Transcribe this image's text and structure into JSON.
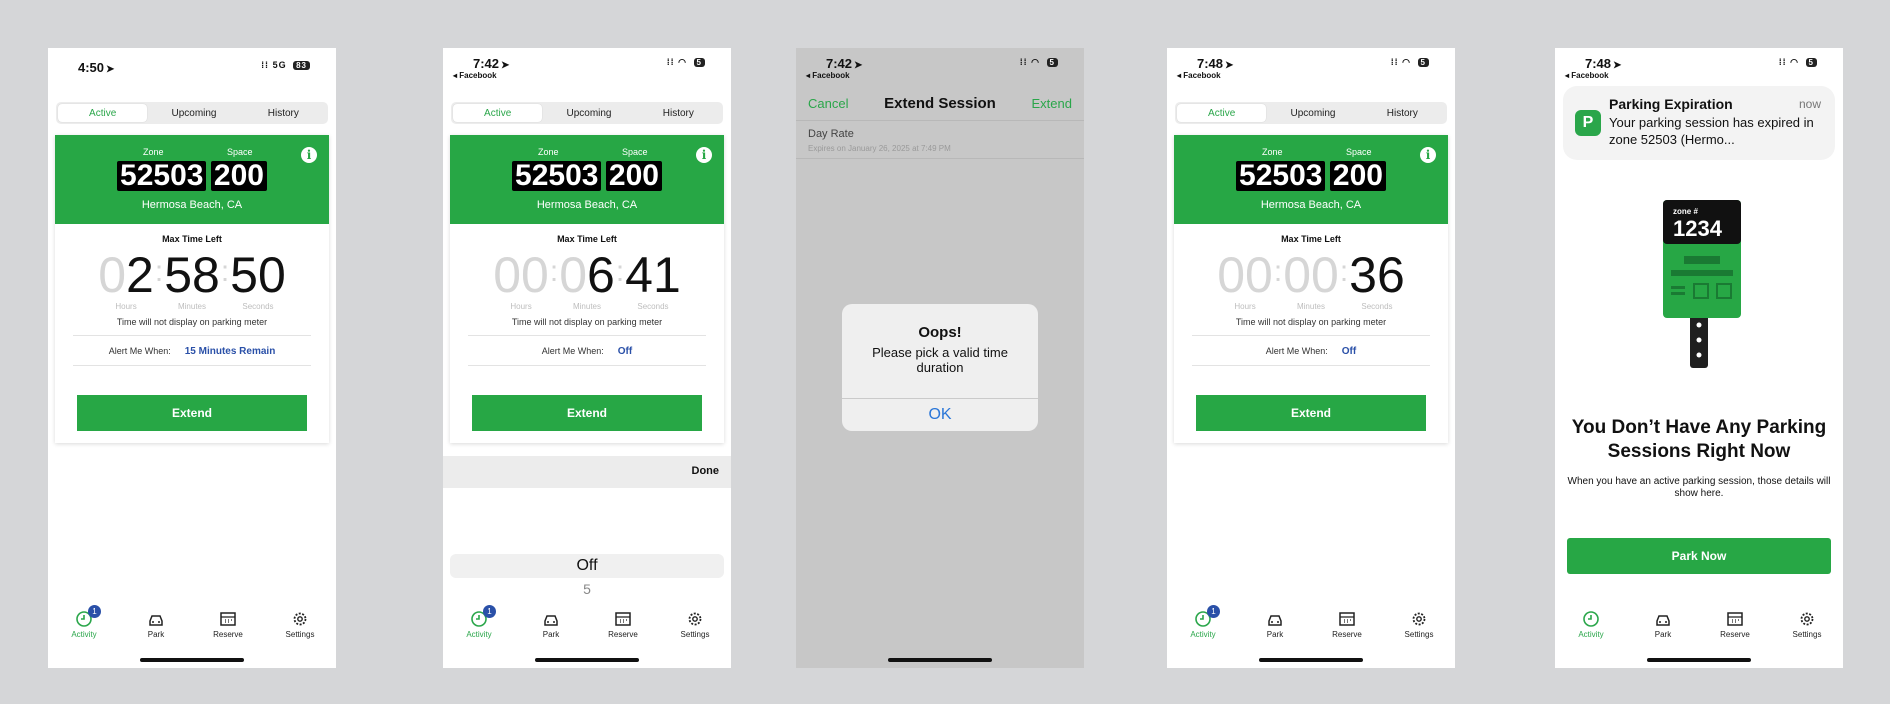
{
  "colors": {
    "brand_green": "#27a745",
    "alert_blue": "#2a50a8",
    "ios_blue": "#2a76d8"
  },
  "screen1": {
    "time": "4:50",
    "signal": "5G",
    "battery": "83",
    "tabs": [
      "Active",
      "Upcoming",
      "History"
    ],
    "zone_label": "Zone",
    "space_label": "Space",
    "zone": "52503",
    "space": "200",
    "city": "Hermosa Beach, CA",
    "max_time_label": "Max Time Left",
    "hours_dim": "0",
    "hours_main": "2",
    "minutes": "58",
    "seconds": "50",
    "unit_hours": "Hours",
    "unit_minutes": "Minutes",
    "unit_seconds": "Seconds",
    "meter_note": "Time will not display on parking meter",
    "alert_label": "Alert Me When:",
    "alert_value": "15 Minutes Remain",
    "extend": "Extend",
    "badge": "1",
    "nav": [
      "Activity",
      "Park",
      "Reserve",
      "Settings"
    ]
  },
  "screen2": {
    "time": "7:42",
    "back_app": "◂ Facebook",
    "battery": "5",
    "tabs": [
      "Active",
      "Upcoming",
      "History"
    ],
    "zone_label": "Zone",
    "space_label": "Space",
    "zone": "52503",
    "space": "200",
    "city": "Hermosa Beach, CA",
    "max_time_label": "Max Time Left",
    "hours": "00",
    "minutes_dim": "0",
    "minutes_main": "6",
    "seconds": "41",
    "unit_hours": "Hours",
    "unit_minutes": "Minutes",
    "unit_seconds": "Seconds",
    "meter_note": "Time will not display on parking meter",
    "alert_label": "Alert Me When:",
    "alert_value": "Off",
    "extend": "Extend",
    "done": "Done",
    "picker_selected": "Off",
    "picker_next": "5",
    "badge": "1",
    "nav": [
      "Activity",
      "Park",
      "Reserve",
      "Settings"
    ]
  },
  "screen3": {
    "time": "7:42",
    "back_app": "◂ Facebook",
    "battery": "5",
    "cancel": "Cancel",
    "title": "Extend Session",
    "extend": "Extend",
    "rate_title": "Day Rate",
    "rate_sub": "Expires on January 26, 2025 at 7:49 PM",
    "alert_title": "Oops!",
    "alert_message": "Please pick a valid time duration",
    "alert_ok": "OK"
  },
  "screen4": {
    "time": "7:48",
    "back_app": "◂ Facebook",
    "battery": "5",
    "tabs": [
      "Active",
      "Upcoming",
      "History"
    ],
    "zone_label": "Zone",
    "space_label": "Space",
    "zone": "52503",
    "space": "200",
    "city": "Hermosa Beach, CA",
    "max_time_label": "Max Time Left",
    "hours": "00",
    "minutes": "00",
    "seconds": "36",
    "unit_hours": "Hours",
    "unit_minutes": "Minutes",
    "unit_seconds": "Seconds",
    "meter_note": "Time will not display on parking meter",
    "alert_label": "Alert Me When:",
    "alert_value": "Off",
    "extend": "Extend",
    "badge": "1",
    "nav": [
      "Activity",
      "Park",
      "Reserve",
      "Settings"
    ]
  },
  "screen5": {
    "time": "7:48",
    "back_app": "◂ Facebook",
    "battery": "5",
    "notif_title": "Parking Expiration",
    "notif_time": "now",
    "notif_body": "Your parking session has expired in zone 52503 (Hermo...",
    "notif_icon": "P",
    "sign_zone_label": "zone #",
    "sign_zone": "1234",
    "empty_title": "You Don’t Have Any Parking Sessions Right Now",
    "empty_sub": "When you have an active parking session, those details will show here.",
    "park_now": "Park Now",
    "nav": [
      "Activity",
      "Park",
      "Reserve",
      "Settings"
    ]
  }
}
